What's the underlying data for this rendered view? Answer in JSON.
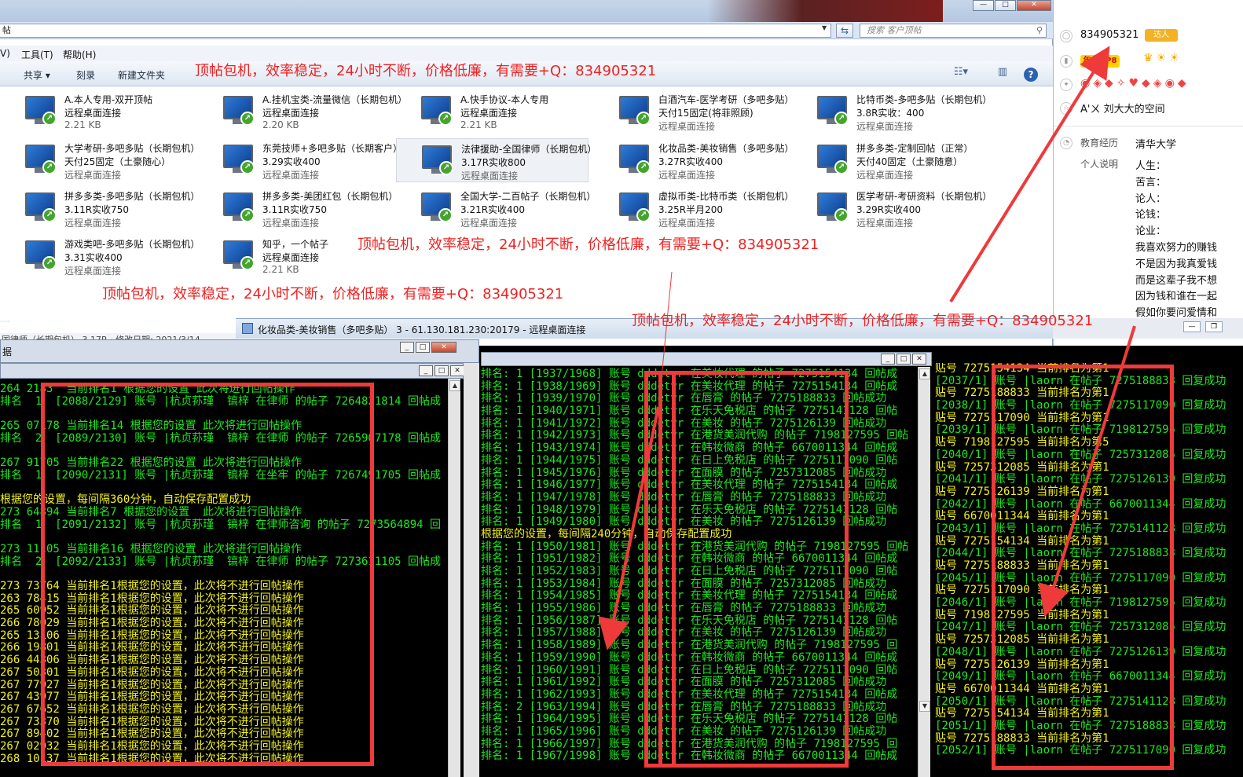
{
  "explorer": {
    "address_text": "帖",
    "search_placeholder": "搜索 客户顶帖",
    "menu": [
      "V)",
      "工具(T)",
      "帮助(H)"
    ],
    "toolbar": {
      "share": "共享 ▾",
      "burn": "刻录",
      "new_folder": "新建文件夹"
    },
    "status_text": "国律师（长期包机）  3.17R  ·  修改日期: 2021/3/14",
    "items": [
      {
        "line1": "A.本人专用-双开顶帖",
        "line2": "远程桌面连接",
        "line3": "2.21 KB"
      },
      {
        "line1": "A.挂机宝类-流量微信（长期包机）",
        "line2": "远程桌面连接",
        "line3": "2.20 KB"
      },
      {
        "line1": "A.快手协议-本人专用",
        "line2": "远程桌面连接",
        "line3": "2.21 KB"
      },
      {
        "line1": "白酒汽车-医学考研（多吧多贴）",
        "line2": "天付15固定(将菲照顾)",
        "line3": "远程桌面连接"
      },
      {
        "line1": "比特币类-多吧多贴（长期包机）",
        "line2": "3.8R实收：400",
        "line3": "远程桌面连接"
      },
      {
        "line1": "大学考研-多吧多贴（长期包机）",
        "line2": "     天付25固定（土豪随心）",
        "line3": "远程桌面连接"
      },
      {
        "line1": "东莞技师+多吧多贴（长期客户）",
        "line2": "3.29实收400",
        "line3": "远程桌面连接"
      },
      {
        "line1": "法律援助-全国律师（长期包机）",
        "line2": "3.17R实收800",
        "line3": "远程桌面连接"
      },
      {
        "line1": "化妆品类-美妆销售（多吧多贴）",
        "line2": "3.27R实收400",
        "line3": "远程桌面连接"
      },
      {
        "line1": "拼多多类-定制回帖（正常）",
        "line2": "天付40固定（土豪随意）",
        "line3": "远程桌面连接"
      },
      {
        "line1": "拼多多类-多吧多贴（长期包机）",
        "line2": "3.11R实收750",
        "line3": "远程桌面连接"
      },
      {
        "line1": "拼多多类-美团红包（长期包机）",
        "line2": "3.11R实收750",
        "line3": "远程桌面连接"
      },
      {
        "line1": "全国大学-二百帖子（长期包机）",
        "line2": "3.21R实收400",
        "line3": "远程桌面连接"
      },
      {
        "line1": "虚拟币类-比特币类（长期包机）",
        "line2": "3.25R半月200",
        "line3": "远程桌面连接"
      },
      {
        "line1": "医学考研-考研资料（长期包机）",
        "line2": "3.29R实收400",
        "line3": "远程桌面连接"
      },
      {
        "line1": "游戏类吧-多吧多贴（长期包机）",
        "line2": "3.31实收400",
        "line3": "远程桌面连接"
      },
      {
        "line1": "知乎，一个帖子",
        "line2": "远程桌面连接",
        "line3": "2.21 KB"
      }
    ]
  },
  "ad_text": "顶帖包机，效率稳定，24小时不断，价格低廉，有需要+Q：834905321",
  "qq_profile": {
    "qq_number": "834905321",
    "badge_daren": "达人",
    "badge_vip": "年SVIP8",
    "space_name": "刘大大的空间",
    "space_prefix": "A'ㄨ",
    "education_label": "教育经历",
    "education_value": "清华大学",
    "bio_label": "个人说明",
    "bio_lines": [
      "人生：",
      "苦言：",
      "论人：",
      "论钱：",
      "论业：",
      "我喜欢努力的赚钱",
      "不是因为我真爱钱",
      "而是这辈子我不想",
      "因为钱和谁在一起",
      "假如你要问爱情和"
    ]
  },
  "rdp": {
    "title": "化妆品类-美妆销售（多吧多贴） 3 - 61.130.181.230:20179 - 远程桌面连接"
  },
  "console1": {
    "title": "据",
    "lines": [
      {
        "c": "g",
        "t": "264 2183  当前排名1 根据您的设置 此次将进行回帖操作"
      },
      {
        "c": "g",
        "t": "排名  1  [2088/2129] 账号 |杭贞荪瑾  镐梓 在律师 的帖子 7264821814 回帖成"
      },
      {
        "c": "g",
        "t": ""
      },
      {
        "c": "g",
        "t": "265 07178 当前排名14 根据您的设置 此次将进行回帖操作"
      },
      {
        "c": "g",
        "t": "排名  2  [2089/2130] 账号 |杭贞荪瑾  镐梓 在律师 的帖子 7265907178 回帖成"
      },
      {
        "c": "g",
        "t": ""
      },
      {
        "c": "g",
        "t": "267 91705 当前排名22 根据您的设置 此次将进行回帖操作"
      },
      {
        "c": "g",
        "t": "排名  1  [2090/2131] 账号 |杭贞荪瑾  镐梓 在坐牢 的帖子 7267491705 回帖成"
      },
      {
        "c": "g",
        "t": ""
      },
      {
        "c": "y",
        "t": "根据您的设置，每间隔360分钟，自动保存配置成功"
      },
      {
        "c": "g",
        "t": "273 64894 当前排名7 根据您的设置  此次将进行回帖操作"
      },
      {
        "c": "g",
        "t": "排名  1  [2091/2132] 账号 |杭贞荪瑾  镐梓 在律师咨询 的帖子 7273564894 回"
      },
      {
        "c": "g",
        "t": ""
      },
      {
        "c": "g",
        "t": "273 11105 当前排名16 根据您的设置 此次将进行回帖操作"
      },
      {
        "c": "g",
        "t": "排名  2  [2092/2133] 账号 |杭贞荪瑾  镐梓 在律师 的帖子 7273611105 回帖成"
      },
      {
        "c": "g",
        "t": ""
      },
      {
        "c": "y",
        "t": "273 73764 当前排名1根据您的设置，此次将不进行回帖操作"
      },
      {
        "c": "y",
        "t": "263 78415 当前排名1根据您的设置，此次将不进行回帖操作"
      },
      {
        "c": "y",
        "t": "265 60952 当前排名1根据您的设置，此次将不进行回帖操作"
      },
      {
        "c": "y",
        "t": "266 78029 当前排名1根据您的设置，此次将不进行回帖操作"
      },
      {
        "c": "y",
        "t": "265 13106 当前排名1根据您的设置，此次将不进行回帖操作"
      },
      {
        "c": "y",
        "t": "266 19801 当前排名1根据您的设置，此次将不进行回帖操作"
      },
      {
        "c": "y",
        "t": "266 44306 当前排名1根据您的设置，此次将不进行回帖操作"
      },
      {
        "c": "y",
        "t": "267 50301 当前排名1根据您的设置，此次将不进行回帖操作"
      },
      {
        "c": "y",
        "t": "267 77927 当前排名1根据您的设置，此次将不进行回帖操作"
      },
      {
        "c": "y",
        "t": "267 43977 当前排名1根据您的设置，此次将不进行回帖操作"
      },
      {
        "c": "y",
        "t": "267 67652 当前排名1根据您的设置，此次将不进行回帖操作"
      },
      {
        "c": "y",
        "t": "267 73370 当前排名1根据您的设置，此次将不进行回帖操作"
      },
      {
        "c": "y",
        "t": "267 89402 当前排名1根据您的设置，此次将不进行回帖操作"
      },
      {
        "c": "y",
        "t": "267 02932 当前排名1根据您的设置，此次将不进行回帖操作"
      },
      {
        "c": "y",
        "t": "268 10137 当前排名1根据您的设置，此次将不进行回帖操作"
      }
    ]
  },
  "console2": {
    "lines": [
      {
        "c": "g",
        "t": "排名: 1 [1937/1968] 账号 dddetvr 在美妆代理 的帖子 7275154134 回帖成"
      },
      {
        "c": "g",
        "t": "排名: 1 [1938/1969] 账号 dddetvr 在美妆代理 的帖子 7275154134 回帖成"
      },
      {
        "c": "g",
        "t": "排名: 1 [1939/1970] 账号 dddetvr 在唇膏 的帖子 7275188833 回帖成功"
      },
      {
        "c": "g",
        "t": "排名: 1 [1940/1971] 账号 dddetvr 在乐天免税店 的帖子 7275141128 回帖"
      },
      {
        "c": "g",
        "t": "排名: 1 [1941/1972] 账号 dddetvr 在美妆 的帖子 7275126139 回帖成功"
      },
      {
        "c": "g",
        "t": "排名: 1 [1942/1973] 账号 dddetvr 在港货美润代购 的帖子 7198127595 回帖"
      },
      {
        "c": "g",
        "t": "排名: 1 [1943/1974] 账号 dddetvr 在韩妆微商 的帖子 6670011344 回帖成"
      },
      {
        "c": "g",
        "t": "排名: 1 [1944/1975] 账号 dddetvr 在日上免税店 的帖子 7275117090 回帖"
      },
      {
        "c": "g",
        "t": "排名: 1 [1945/1976] 账号 dddetvr 在面膜 的帖子 7257312085 回帖成功"
      },
      {
        "c": "g",
        "t": "排名: 1 [1946/1977] 账号 dddetvr 在美妆代理 的帖子 7275154134 回帖成"
      },
      {
        "c": "g",
        "t": "排名: 1 [1947/1978] 账号 dddetvr 在唇膏 的帖子 7275188833 回帖成功"
      },
      {
        "c": "g",
        "t": "排名: 1 [1948/1979] 账号 dddetvr 在乐天免税店 的帖子 7275141128 回帖"
      },
      {
        "c": "g",
        "t": "排名: 1 [1949/1980] 账号 dddetvr 在美妆 的帖子 7275126139 回帖成功"
      },
      {
        "c": "y",
        "t": "根据您的设置，每间隔240分钟，自动保存配置成功"
      },
      {
        "c": "g",
        "t": "排名: 1 [1950/1981] 账号 dddetvr 在港货美润代购 的帖子 7198127595 回帖"
      },
      {
        "c": "g",
        "t": "排名: 1 [1951/1982] 账号 dddetvr 在韩妆微商 的帖子 6670011344 回帖成"
      },
      {
        "c": "g",
        "t": "排名: 1 [1952/1983] 账号 dddetvr 在日上免税店 的帖子 7275117090 回帖"
      },
      {
        "c": "g",
        "t": "排名: 1 [1953/1984] 账号 dddetvr 在面膜 的帖子 7257312085 回帖成功"
      },
      {
        "c": "g",
        "t": "排名: 1 [1954/1985] 账号 dddetvr 在美妆代理 的帖子 7275154134 回帖成"
      },
      {
        "c": "g",
        "t": "排名: 1 [1955/1986] 账号 dddetvr 在唇膏 的帖子 7275188833 回帖成功"
      },
      {
        "c": "g",
        "t": "排名: 1 [1956/1987] 账号 dddetvr 在乐天免税店 的帖子 7275141128 回帖"
      },
      {
        "c": "g",
        "t": "排名: 1 [1957/1988] 账号 dddetvr 在美妆 的帖子 7275126139 回帖成功"
      },
      {
        "c": "g",
        "t": "排名: 1 [1958/1989] 账号 dddetvr 在港货美润代购 的帖子 7198127595 回"
      },
      {
        "c": "g",
        "t": "排名: 1 [1959/1990] 账号 dddetvr 在韩妆微商 的帖子 6670011344 回帖成"
      },
      {
        "c": "g",
        "t": "排名: 1 [1960/1991] 账号 dddetvr 在日上免税店 的帖子 7275117090 回帖"
      },
      {
        "c": "g",
        "t": "排名: 1 [1961/1992] 账号 dddetvr 在面膜 的帖子 7257312085 回帖成功"
      },
      {
        "c": "g",
        "t": "排名: 1 [1962/1993] 账号 dddetvr 在美妆代理 的帖子 7275154134 回帖成"
      },
      {
        "c": "g",
        "t": "排名: 2 [1963/1994] 账号 dddetvr 在唇膏 的帖子 7275188833 回帖成功"
      },
      {
        "c": "g",
        "t": "排名: 1 [1964/1995] 账号 dddetvr 在乐天免税店 的帖子 7275141128 回帖"
      },
      {
        "c": "g",
        "t": "排名: 1 [1965/1996] 账号 dddetvr 在美妆 的帖子 7275126139 回帖成功"
      },
      {
        "c": "g",
        "t": "排名: 1 [1966/1997] 账号 dddetvr 在港货美润代购 的帖子 7198127595 回"
      },
      {
        "c": "g",
        "t": "排名: 1 [1967/1998] 账号 dddetvr 在韩妆微商 的帖子 6670011344 回帖成"
      }
    ]
  },
  "console3": {
    "lines": [
      {
        "c": "y",
        "t": "贴号 7275154134 当前排名为第1"
      },
      {
        "c": "g",
        "t": "[2037/1] 账号 |laorn 在帖子 7275188833 回复成功"
      },
      {
        "c": "y",
        "t": "贴号 7275188833 当前排名为第1"
      },
      {
        "c": "g",
        "t": "[2038/1] 账号 |laorn 在帖子 7275117090 回复成功"
      },
      {
        "c": "y",
        "t": "贴号 7275117090 当前排名为第1"
      },
      {
        "c": "g",
        "t": "[2039/1] 账号 |laorn 在帖子 7198127595 回复成功"
      },
      {
        "c": "y",
        "t": "贴号 7198127595 当前排名为第5"
      },
      {
        "c": "g",
        "t": "[2040/1] 账号 |laorn 在帖子 7257312085 回复成功"
      },
      {
        "c": "y",
        "t": "贴号 7257312085 当前排名为第1"
      },
      {
        "c": "g",
        "t": "[2041/1] 账号 |laorn 在帖子 7275126139 回复成功"
      },
      {
        "c": "y",
        "t": "贴号 7275126139 当前排名为第1"
      },
      {
        "c": "g",
        "t": "[2042/1] 账号 |laorn 在帖子 6670011344 回复成功"
      },
      {
        "c": "y",
        "t": "贴号 6670011344 当前排名为第1"
      },
      {
        "c": "g",
        "t": "[2043/1] 账号 |laorn 在帖子 7275141128 回复成功"
      },
      {
        "c": "y",
        "t": "贴号 7275154134 当前排名为第1"
      },
      {
        "c": "g",
        "t": "[2044/1] 账号 |laorn 在帖子 7275188833 回复成功"
      },
      {
        "c": "y",
        "t": "贴号 7275188833 当前排名为第1"
      },
      {
        "c": "g",
        "t": "[2045/1] 账号 |laorn 在帖子 7275117090 回复成功"
      },
      {
        "c": "y",
        "t": "贴号 7275117090 当前排名为第1"
      },
      {
        "c": "g",
        "t": "[2046/1] 账号 |laorn 在帖子 7198127595 回复成功"
      },
      {
        "c": "y",
        "t": "贴号 7198127595 当前排名为第1"
      },
      {
        "c": "g",
        "t": "[2047/1] 账号 |laorn 在帖子 7257312085 回复成功"
      },
      {
        "c": "y",
        "t": "贴号 7257312085 当前排名为第1"
      },
      {
        "c": "g",
        "t": "[2048/1] 账号 |laorn 在帖子 7275126139 回复成功"
      },
      {
        "c": "y",
        "t": "贴号 7275126139 当前排名为第1"
      },
      {
        "c": "g",
        "t": "[2049/1] 账号 |laorn 在帖子 6670011344 回复成功"
      },
      {
        "c": "y",
        "t": "贴号 6670011344 当前排名为第1"
      },
      {
        "c": "g",
        "t": "[2050/1] 账号 |laorn 在帖子 7275141128 回复成功"
      },
      {
        "c": "y",
        "t": "贴号 7275154134 当前排名为第1"
      },
      {
        "c": "g",
        "t": "[2051/1] 账号 |laorn 在帖子 7275188833 回复成功"
      },
      {
        "c": "y",
        "t": "贴号 7275188833 当前排名为第1"
      },
      {
        "c": "g",
        "t": "[2052/1] 账号 |laorn 在帖子 7275117090 回复成功"
      }
    ]
  },
  "colors": {
    "annotation_red": "#ee3a3a",
    "console_green": "#1ce81c",
    "console_yellow": "#f2f21a"
  }
}
